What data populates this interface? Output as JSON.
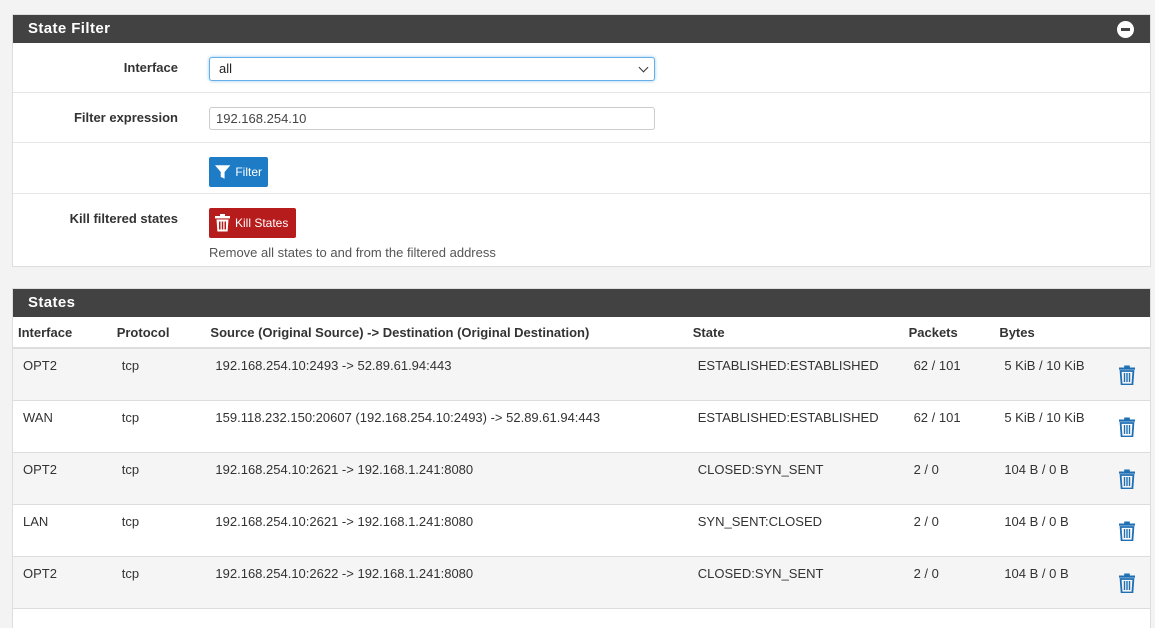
{
  "state_filter": {
    "title": "State Filter",
    "interface_label": "Interface",
    "interface_value": "all",
    "filter_expression_label": "Filter expression",
    "filter_expression_value": "192.168.254.10",
    "filter_button_label": "Filter",
    "kill_label": "Kill filtered states",
    "kill_button_label": "Kill States",
    "kill_help": "Remove all states to and from the filtered address"
  },
  "states": {
    "title": "States",
    "columns": [
      "Interface",
      "Protocol",
      "Source (Original Source) -> Destination (Original Destination)",
      "State",
      "Packets",
      "Bytes"
    ],
    "rows": [
      {
        "interface": "OPT2",
        "protocol": "tcp",
        "src_dst": "192.168.254.10:2493 -> 52.89.61.94:443",
        "state": "ESTABLISHED:ESTABLISHED",
        "packets": "62 / 101",
        "bytes": "5 KiB / 10 KiB"
      },
      {
        "interface": "WAN",
        "protocol": "tcp",
        "src_dst": "159.118.232.150:20607 (192.168.254.10:2493) -> 52.89.61.94:443",
        "state": "ESTABLISHED:ESTABLISHED",
        "packets": "62 / 101",
        "bytes": "5 KiB / 10 KiB"
      },
      {
        "interface": "OPT2",
        "protocol": "tcp",
        "src_dst": "192.168.254.10:2621 -> 192.168.1.241:8080",
        "state": "CLOSED:SYN_SENT",
        "packets": "2 / 0",
        "bytes": "104 B / 0 B"
      },
      {
        "interface": "LAN",
        "protocol": "tcp",
        "src_dst": "192.168.254.10:2621 -> 192.168.1.241:8080",
        "state": "SYN_SENT:CLOSED",
        "packets": "2 / 0",
        "bytes": "104 B / 0 B"
      },
      {
        "interface": "OPT2",
        "protocol": "tcp",
        "src_dst": "192.168.254.10:2622 -> 192.168.1.241:8080",
        "state": "CLOSED:SYN_SENT",
        "packets": "2 / 0",
        "bytes": "104 B / 0 B"
      }
    ]
  },
  "colors": {
    "header_bg": "#424242",
    "filter_button": "#1e7bc6",
    "kill_button": "#b71c1c",
    "trash_icon": "#1e6fb3"
  },
  "icons": [
    "collapse-icon",
    "filter-icon",
    "trash-icon"
  ]
}
